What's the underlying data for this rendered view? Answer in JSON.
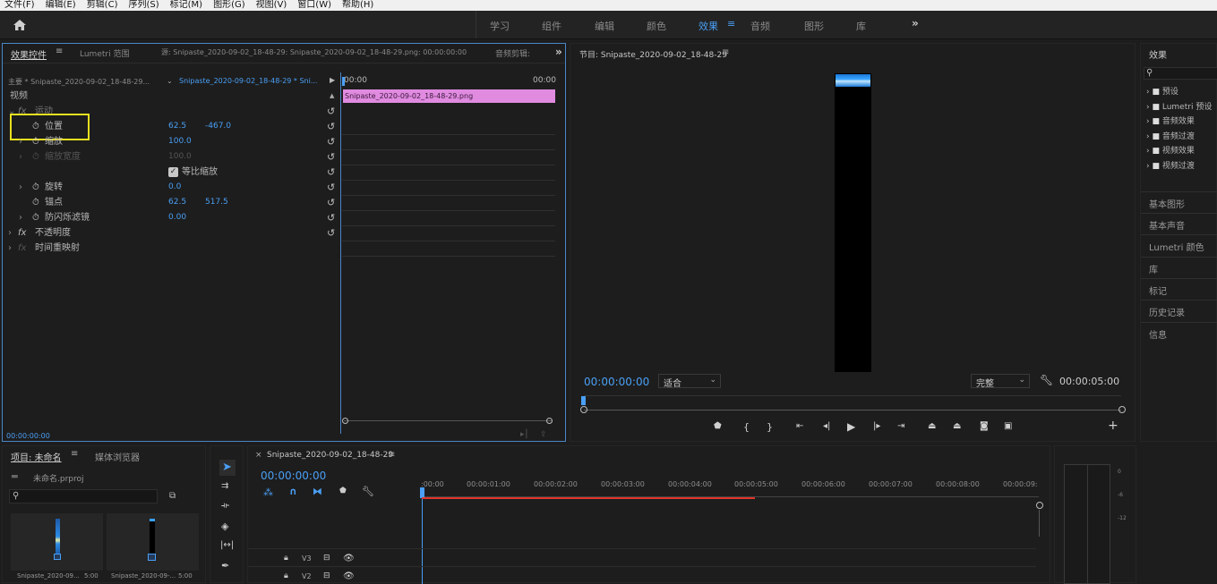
{
  "menu": [
    "文件(F)",
    "编辑(E)",
    "剪辑(C)",
    "序列(S)",
    "标记(M)",
    "图形(G)",
    "视图(V)",
    "窗口(W)",
    "帮助(H)"
  ],
  "workspaces": [
    "学习",
    "组件",
    "编辑",
    "颜色",
    "效果",
    "音频",
    "图形",
    "库"
  ],
  "workspace_active_index": 4,
  "ec": {
    "tab_effect_controls": "效果控件",
    "tab_lumetri": "Lumetri 范围",
    "tab_source": "源: Snipaste_2020-09-02_18-48-29: Snipaste_2020-09-02_18-48-29.png: 00:00:00:00",
    "tab_audio": "音频剪辑:",
    "master_label": "主要 * Snipaste_2020-09-02_18-48-29...",
    "seq_label": "Snipaste_2020-09-02_18-48-29 * Sni...",
    "video_label": "视频",
    "motion": "运动",
    "position": "位置",
    "pos_x": "62.5",
    "pos_y": "-467.0",
    "scale": "缩放",
    "scale_val": "100.0",
    "scale_width": "缩放宽度",
    "scale_width_val": "100.0",
    "uniform_scale": "等比缩放",
    "rotation": "旋转",
    "rotation_val": "0.0",
    "anchor": "锚点",
    "anchor_x": "62.5",
    "anchor_y": "517.5",
    "flicker": "防闪烁滤镜",
    "flicker_val": "0.00",
    "opacity": "不透明度",
    "time_remap": "时间重映射",
    "mini_start": "00:00",
    "mini_end": "00:00",
    "clip_name": "Snipaste_2020-09-02_18-48-29.png",
    "timecode": "00:00:00:00"
  },
  "program": {
    "title": "节目: Snipaste_2020-09-02_18-48-29",
    "timecode": "00:00:00:00",
    "fit": "适合",
    "quality": "完整",
    "duration": "00:00:05:00"
  },
  "effects": {
    "title": "效果",
    "folders": [
      "预设",
      "Lumetri 预设",
      "音频效果",
      "音频过渡",
      "视频效果",
      "视频过渡"
    ],
    "side_items": [
      "基本图形",
      "基本声音",
      "Lumetri 颜色",
      "库",
      "标记",
      "历史记录",
      "信息"
    ]
  },
  "project": {
    "tab_project": "项目: 未命名",
    "tab_media": "媒体浏览器",
    "file": "未命名.prproj",
    "thumb1_name": "Snipaste_2020-09...",
    "thumb1_dur": "5:00",
    "thumb2_name": "Snipaste_2020-09-...",
    "thumb2_dur": "5:00"
  },
  "timeline": {
    "tab": "Snipaste_2020-09-02_18-48-29",
    "timecode": "00:00:00:00",
    "ticks": [
      ":00:00",
      "00:00:01:00",
      "00:00:02:00",
      "00:00:03:00",
      "00:00:04:00",
      "00:00:05:00",
      "00:00:06:00",
      "00:00:07:00",
      "00:00:08:00",
      "00:00:09:"
    ],
    "tracks": [
      "V3",
      "V2"
    ],
    "meter_labels": [
      "0",
      "-6",
      "-12"
    ]
  },
  "colors": {
    "accent": "#4a9ff5",
    "clip": "#e08ae0",
    "highlight": "#e8e020",
    "red": "#e0342a"
  }
}
